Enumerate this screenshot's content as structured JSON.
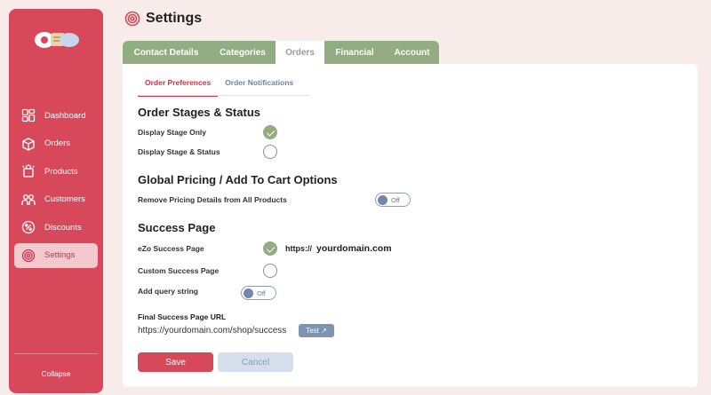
{
  "sidebar": {
    "items": [
      {
        "label": "Dashboard",
        "icon": "dashboard-icon"
      },
      {
        "label": "Orders",
        "icon": "orders-icon"
      },
      {
        "label": "Products",
        "icon": "products-icon"
      },
      {
        "label": "Customers",
        "icon": "customers-icon"
      },
      {
        "label": "Discounts",
        "icon": "discounts-icon"
      },
      {
        "label": "Settings",
        "icon": "settings-icon",
        "active": true
      }
    ],
    "collapse_label": "Collapse"
  },
  "header": {
    "title": "Settings"
  },
  "tabs": [
    {
      "label": "Contact Details"
    },
    {
      "label": "Categories"
    },
    {
      "label": "Orders",
      "active": true
    },
    {
      "label": "Financial"
    },
    {
      "label": "Account"
    }
  ],
  "subtabs": [
    {
      "label": "Order Preferences",
      "active": true
    },
    {
      "label": "Order Notifications"
    }
  ],
  "order_stages": {
    "title": "Order Stages & Status",
    "options": [
      {
        "label": "Display Stage Only",
        "checked": true
      },
      {
        "label": "Display Stage & Status",
        "checked": false
      }
    ]
  },
  "global_pricing": {
    "title": "Global Pricing / Add To Cart Options",
    "remove_pricing_label": "Remove Pricing Details from All Products",
    "remove_pricing_toggle": "Off"
  },
  "success_page": {
    "title": "Success Page",
    "ezo_label": "eZo Success Page",
    "ezo_checked": true,
    "url_prefix": "https://",
    "url_domain": "yourdomain.com",
    "custom_label": "Custom Success Page",
    "custom_checked": false,
    "query_label": "Add query string",
    "query_toggle": "Off",
    "final_label": "Final Success Page URL",
    "final_url": "https://yourdomain.com/shop/success",
    "test_label": "Test ↗"
  },
  "actions": {
    "save_label": "Save",
    "cancel_label": "Cancel"
  },
  "colors": {
    "brand": "#d7485a",
    "tab_green": "#93ad82",
    "accent_blue": "#7d93b4",
    "background": "#f7ece9"
  }
}
